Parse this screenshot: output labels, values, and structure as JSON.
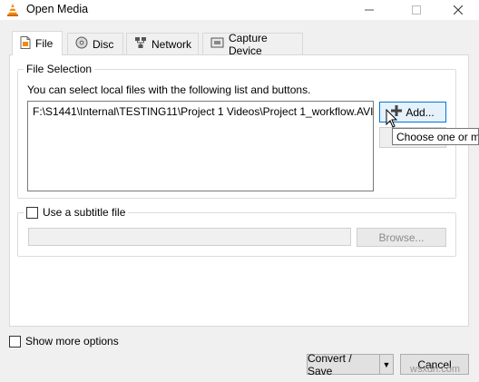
{
  "window": {
    "title": "Open Media",
    "icon": "vlc-cone-icon",
    "controls": {
      "minimize": "—",
      "maximize": "☐",
      "close": "✕"
    }
  },
  "tabs": [
    {
      "label": "File",
      "icon": "file-icon",
      "active": true
    },
    {
      "label": "Disc",
      "icon": "disc-icon",
      "active": false
    },
    {
      "label": "Network",
      "icon": "network-icon",
      "active": false
    },
    {
      "label": "Capture Device",
      "icon": "capture-device-icon",
      "active": false
    }
  ],
  "file_selection": {
    "legend": "File Selection",
    "description": "You can select local files with the following list and buttons.",
    "files": [
      "F:\\S1441\\Internal\\TESTING11\\Project 1 Videos\\Project 1_workflow.AVI"
    ],
    "add_label": "Add...",
    "tooltip": "Choose one or m"
  },
  "subtitle": {
    "checkbox_label": "Use a subtitle file",
    "checked": false,
    "path_value": "",
    "browse_label": "Browse..."
  },
  "options": {
    "show_more_label": "Show more options",
    "checked": false
  },
  "footer": {
    "convert_label": "Convert / Save",
    "cancel_label": "Cancel"
  },
  "watermark": "wsxdn.com",
  "colors": {
    "dialog_bg": "#f0f0f0",
    "accent_border": "#0078d7",
    "vlc_orange": "#f28a0f"
  }
}
